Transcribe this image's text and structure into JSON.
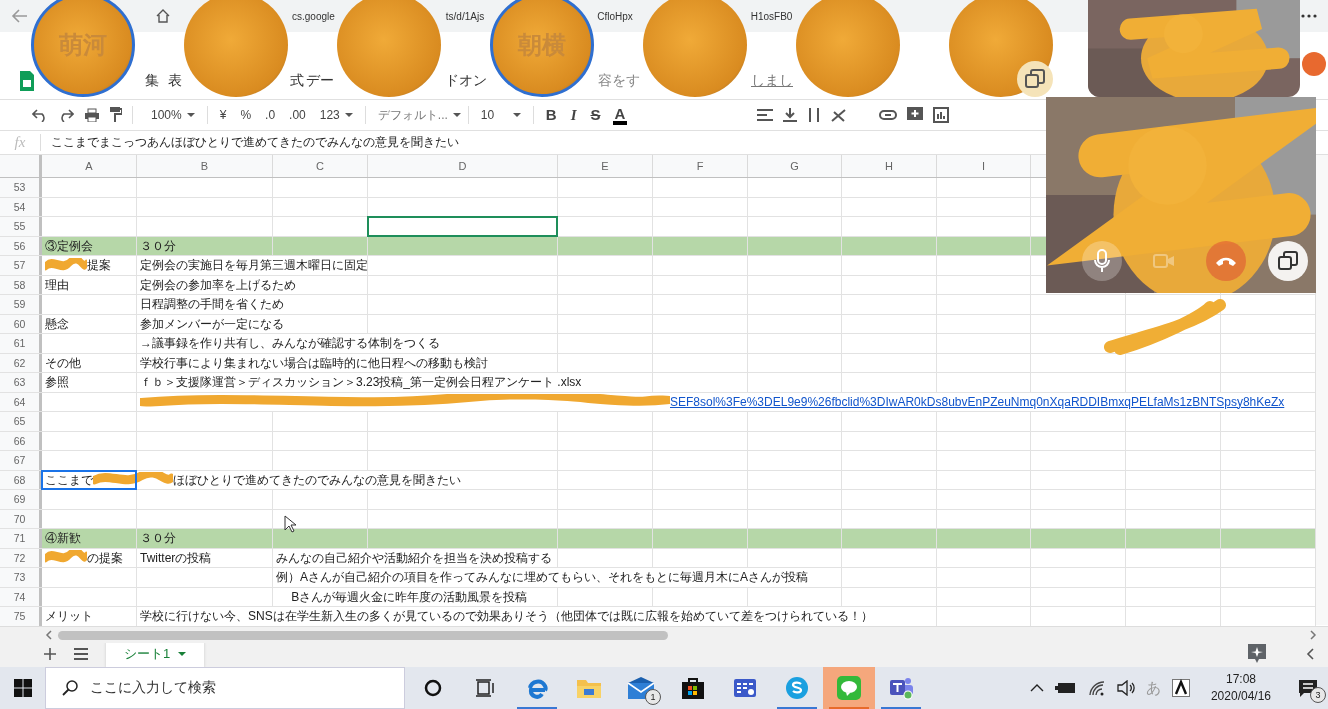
{
  "browser": {
    "url_fragments": [
      "cs.google",
      "ts/d/1Ajs",
      "CfloHpx",
      "H1osFB0"
    ]
  },
  "menu": {
    "items": [
      "集",
      "表",
      "式",
      "デー",
      "ドオン"
    ],
    "search_hint": "容をす",
    "notice": "しまし"
  },
  "toolbar": {
    "zoom": "100%",
    "currency": "¥",
    "percent": "%",
    "decimal_decrease": ".0",
    "decimal_increase": ".00",
    "number_format": "123",
    "font": "デフォルト...",
    "font_size": "10",
    "bold": "B",
    "italic": "I",
    "strikethrough": "S",
    "text_color": "A"
  },
  "formula_bar": {
    "label": "fx",
    "value": "ここまでまこっつあんほぼひとりで進めてきたのでみんなの意見を聞きたい"
  },
  "grid": {
    "columns": [
      "A",
      "B",
      "C",
      "D",
      "E",
      "F",
      "G",
      "H",
      "I"
    ],
    "rows": [
      {
        "number": "53",
        "kind": "plain",
        "cells": {}
      },
      {
        "number": "54",
        "kind": "plain",
        "cells": {}
      },
      {
        "number": "55",
        "kind": "plain",
        "cells": {
          "D": {
            "selected": true,
            "color": "#1e8e5a"
          }
        }
      },
      {
        "number": "56",
        "kind": "section",
        "cells": {
          "A": {
            "text": "③定例会",
            "selected": false
          },
          "B": {
            "text": "３０分",
            "selected": false
          }
        }
      },
      {
        "number": "57",
        "kind": "plain",
        "cells": {
          "A": {
            "segments": [
              {
                "kind": "redacted"
              },
              {
                "kind": "text",
                "text": "提案"
              }
            ],
            "selected": false
          },
          "B": {
            "text": "定例会の実施日を毎月第三週木曜日に固定",
            "selected": false
          }
        }
      },
      {
        "number": "58",
        "kind": "plain",
        "cells": {
          "A": {
            "text": "理由",
            "selected": false
          },
          "B": {
            "text": "定例会の参加率を上げるため",
            "selected": false
          }
        }
      },
      {
        "number": "59",
        "kind": "plain",
        "cells": {
          "B": {
            "text": "日程調整の手間を省くため",
            "selected": false
          }
        }
      },
      {
        "number": "60",
        "kind": "plain",
        "cells": {
          "A": {
            "text": "懸念",
            "selected": false
          },
          "B": {
            "text": "参加メンバーが一定になる",
            "selected": false
          }
        }
      },
      {
        "number": "61",
        "kind": "plain",
        "cells": {
          "B": {
            "text": "→議事録を作り共有し、みんなが確認する体制をつくる",
            "selected": false
          }
        }
      },
      {
        "number": "62",
        "kind": "plain",
        "cells": {
          "A": {
            "text": "その他",
            "selected": false
          },
          "B": {
            "text": "学校行事により集まれない場合は臨時的に他日程への移動も検討",
            "selected": false
          }
        }
      },
      {
        "number": "63",
        "kind": "plain",
        "cells": {
          "A": {
            "text": "参照",
            "selected": false
          },
          "B": {
            "text": "ｆｂ＞支援隊運営＞ディスカッション＞3.23投稿_第一定例会日程アンケート .xlsx",
            "selected": false
          }
        }
      },
      {
        "number": "64",
        "kind": "plain",
        "cells": {
          "B": {
            "kind": "link",
            "segments": [
              {
                "kind": "redacted"
              },
              {
                "kind": "text",
                "text": "SEF8sol%3Fe%3DEL9e9%26fbclid%3DIwAR0kDs8ubvEnPZeuNmq0nXqaRDDIBmxqPELfaMs1zBNTSpsy8hKeZx"
              }
            ],
            "selected": false
          }
        }
      },
      {
        "number": "65",
        "kind": "plain",
        "cells": {}
      },
      {
        "number": "66",
        "kind": "plain",
        "cells": {}
      },
      {
        "number": "67",
        "kind": "plain",
        "cells": {}
      },
      {
        "number": "68",
        "kind": "plain",
        "cells": {
          "A": {
            "segments": [
              {
                "kind": "text",
                "text": "ここまで"
              },
              {
                "kind": "redacted"
              },
              {
                "kind": "text",
                "text": "ほぼひとりで進めてきたのでみんなの意見を聞きたい"
              }
            ],
            "selected": true,
            "color": "#1a73e8"
          }
        }
      },
      {
        "number": "69",
        "kind": "plain",
        "cells": {}
      },
      {
        "number": "70",
        "kind": "plain",
        "cells": {}
      },
      {
        "number": "71",
        "kind": "section",
        "cells": {
          "A": {
            "text": "④新歓",
            "selected": false
          },
          "B": {
            "text": "３０分",
            "selected": false
          }
        }
      },
      {
        "number": "72",
        "kind": "plain",
        "cells": {
          "A": {
            "segments": [
              {
                "kind": "redacted"
              },
              {
                "kind": "text",
                "text": "の提案"
              }
            ],
            "selected": false
          },
          "B": {
            "text": "Twitterの投稿",
            "selected": false
          },
          "C": {
            "text": "みんなの自己紹介や活動紹介を担当を決め投稿する",
            "selected": false
          }
        }
      },
      {
        "number": "73",
        "kind": "plain",
        "cells": {
          "C": {
            "text": "例）Aさんが自己紹介の項目を作ってみんなに埋めてもらい、それをもとに毎週月木にAさんが投稿",
            "selected": false
          }
        }
      },
      {
        "number": "74",
        "kind": "plain",
        "cells": {
          "C": {
            "text": "　 Bさんが毎週火金に昨年度の活動風景を投稿",
            "selected": false
          }
        }
      },
      {
        "number": "75",
        "kind": "plain",
        "cells": {
          "A": {
            "text": "メリット",
            "selected": false
          },
          "B": {
            "text": "学校に行けない今、SNSは在学生新入生の多くが見ているので効果ありそう（他団体では既に広報を始めていて差をつけられている！）",
            "selected": false
          }
        }
      }
    ]
  },
  "sheet_tabs": [
    {
      "label": "シート1",
      "selected": true
    }
  ],
  "avatars": [
    {
      "initials": "萌河",
      "highlighted": true
    },
    {
      "highlighted": false
    },
    {
      "highlighted": false
    },
    {
      "initials": "朝横",
      "highlighted": true
    },
    {
      "highlighted": false
    },
    {
      "highlighted": false
    },
    {
      "highlighted": false
    }
  ],
  "taskbar": {
    "search_placeholder": "ここに入力して検索",
    "apps": [
      {
        "kind": "cortana",
        "running": false,
        "attention": false
      },
      {
        "kind": "taskview",
        "running": false,
        "attention": false
      },
      {
        "kind": "edge",
        "running": true,
        "attention": false
      },
      {
        "kind": "explorer",
        "running": false,
        "attention": false
      },
      {
        "kind": "mail",
        "running": false,
        "attention": false,
        "badge": "1"
      },
      {
        "kind": "store",
        "running": false,
        "attention": false
      },
      {
        "kind": "settings-app",
        "running": false,
        "attention": false
      },
      {
        "kind": "skype",
        "running": true,
        "attention": false
      },
      {
        "kind": "line",
        "running": true,
        "attention": true
      },
      {
        "kind": "teams",
        "running": true,
        "attention": false
      }
    ],
    "ime": "あ",
    "time": "17:08",
    "date": "2020/04/16",
    "notifications": "3"
  }
}
